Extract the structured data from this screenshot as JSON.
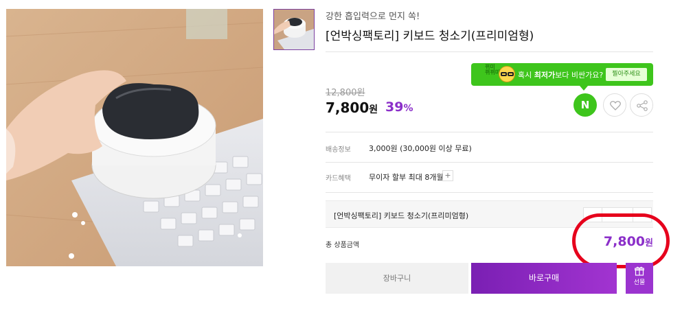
{
  "product": {
    "subtitle": "강한 흡입력으로 먼지 쏙!",
    "title": "[언박싱팩토리] 키보드 청소기(프리미엄형)",
    "original_price": "12,800원",
    "price": "7,800",
    "price_unit": "원",
    "discount": "39",
    "discount_unit": "%"
  },
  "bubble": {
    "tag_line1": "뀌미",
    "tag_line2": "뀌뀌미",
    "text_before": "혹시 ",
    "text_bold": "최저가",
    "text_after": "보다 비싼가요?",
    "button_label": "찔아주세요"
  },
  "icons": {
    "n_label": "N",
    "heart": "heart-icon",
    "share": "share-icon"
  },
  "shipping": {
    "label": "배송정보",
    "value": "3,000원 (30,000원 이상 무료)"
  },
  "card": {
    "label": "카드혜택",
    "value": "무이자 할부 최대 8개월",
    "more": "+"
  },
  "option": {
    "name": "[언박싱팩토리] 키보드 청소기(프리미엄형)"
  },
  "total": {
    "label": "총 상품금액",
    "price": "7,800",
    "unit": "원"
  },
  "buttons": {
    "cart": "장바구니",
    "buy": "바로구매",
    "gift": "선물"
  },
  "colors": {
    "accent_purple": "#8b2fc9",
    "naver_green": "#3ec51c",
    "highlight_red": "#e6001c"
  }
}
